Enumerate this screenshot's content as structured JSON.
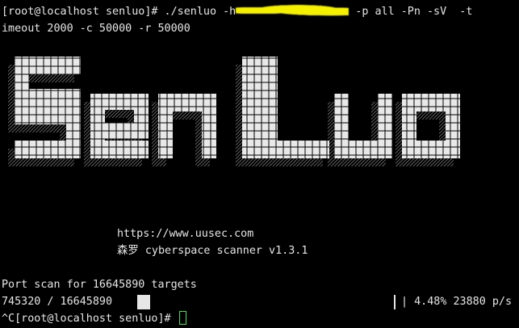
{
  "terminal": {
    "command": {
      "prompt": "[root@localhost senluo]# ",
      "prefix": "./senluo -h",
      "suffix": " -p all -Pn -sV  -t",
      "continuation": "imeout 2000 -c 50000 -r 50000"
    },
    "logo_text": "SenLuo",
    "banner": {
      "url": "https://www.uusec.com",
      "tagline": "森罗 cyberspace scanner v1.3.1"
    },
    "scan": {
      "header": "Port scan for 16645890 targets",
      "progress_text": "745320 / 16645890 ",
      "progress_fraction": 0.0448,
      "stats": "| 4.48% 23880 p/s"
    },
    "final_prompt": "^C[root@localhost senluo]# "
  },
  "colors": {
    "background": "#000000",
    "foreground": "#e6e6e6",
    "redaction": "#f4f000",
    "cursor": "#3fe03f"
  }
}
